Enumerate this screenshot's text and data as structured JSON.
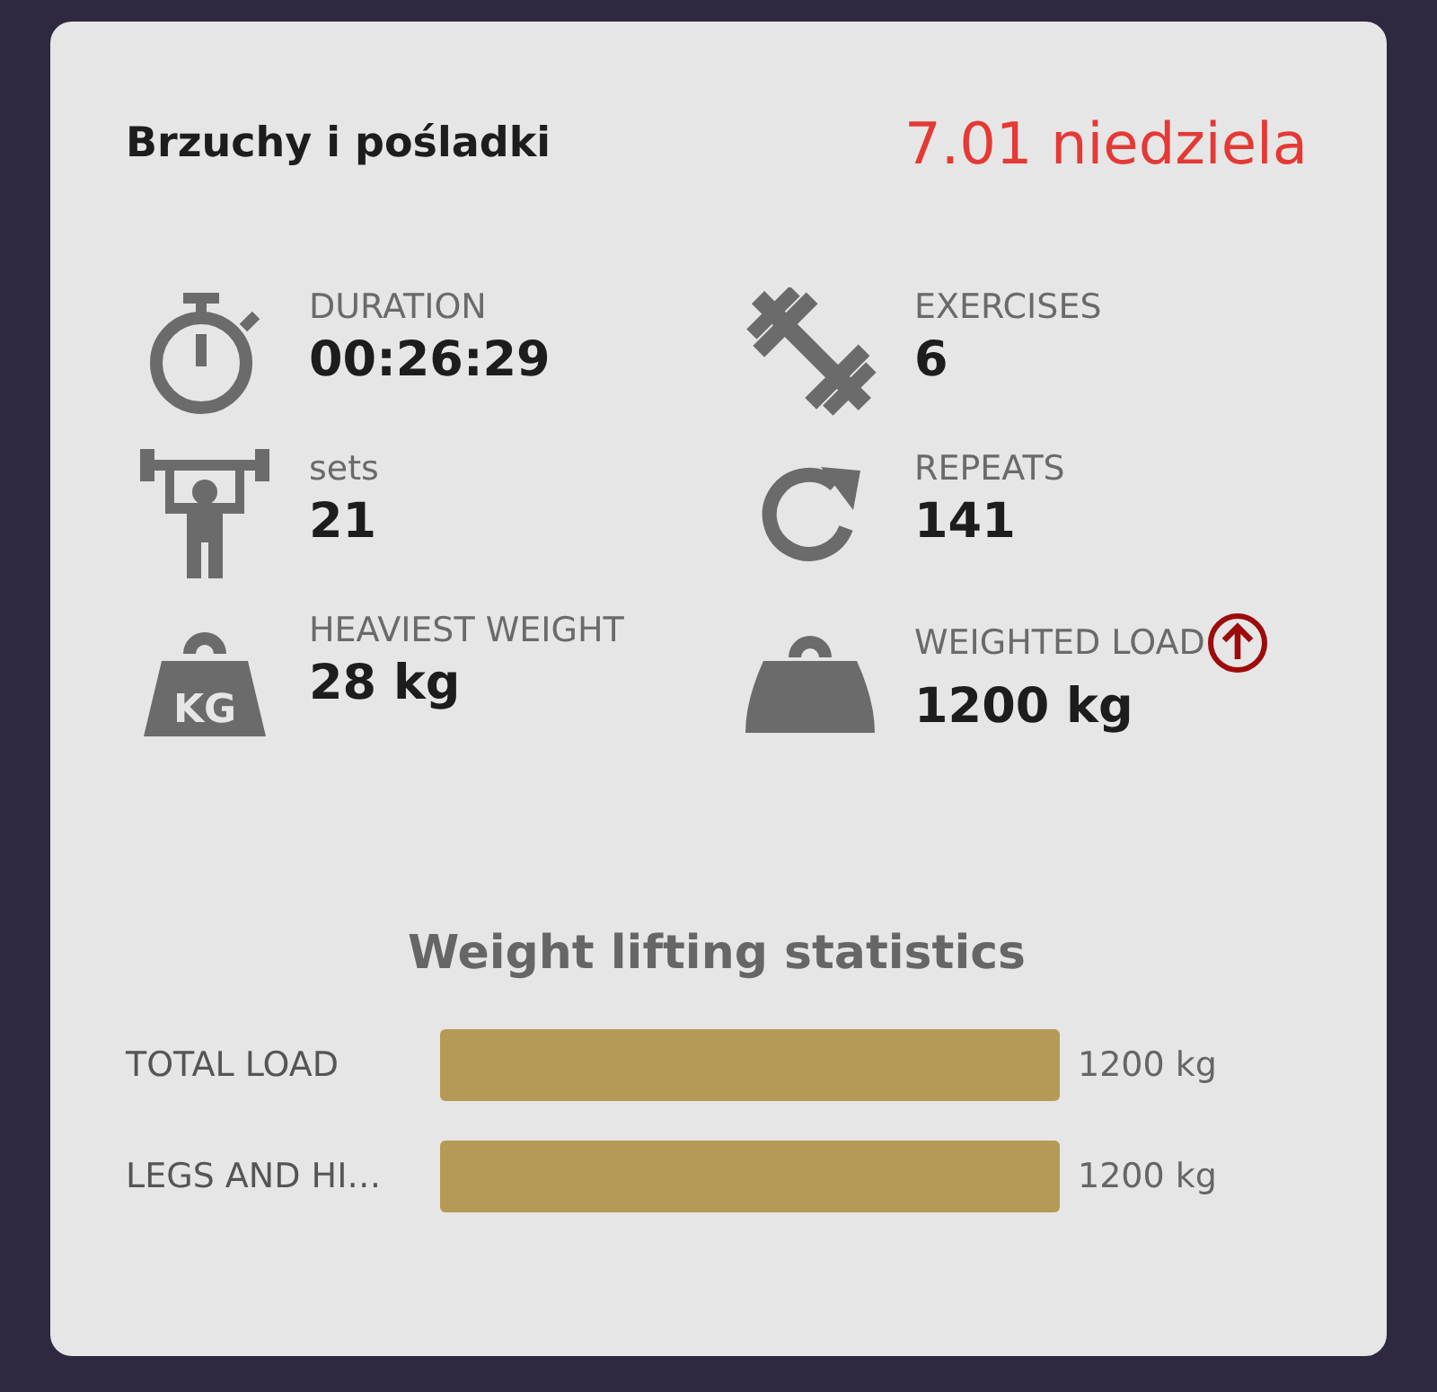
{
  "header": {
    "title": "Brzuchy i pośladki",
    "date": "7.01 niedziela"
  },
  "stats": [
    {
      "kind": "stopwatch",
      "label": "DURATION",
      "value": "00:26:29"
    },
    {
      "kind": "dumbbell",
      "label": "EXERCISES",
      "value": "6"
    },
    {
      "kind": "lifter",
      "label": "sets",
      "value": "21"
    },
    {
      "kind": "repeat",
      "label": "REPEATS",
      "value": "141"
    },
    {
      "kind": "kettlebell",
      "label": "HEAVIEST WEIGHT",
      "value": "28 kg",
      "icon_text": "KG"
    },
    {
      "kind": "weight",
      "label": "WEIGHTED LOAD",
      "value": "1200 kg",
      "rising": true
    }
  ],
  "weight_stats": {
    "title": "Weight lifting statistics",
    "rows": [
      {
        "label": "TOTAL LOAD",
        "reading": "1200 kg"
      },
      {
        "label": "LEGS AND HI…",
        "reading": "1200 kg"
      }
    ]
  }
}
